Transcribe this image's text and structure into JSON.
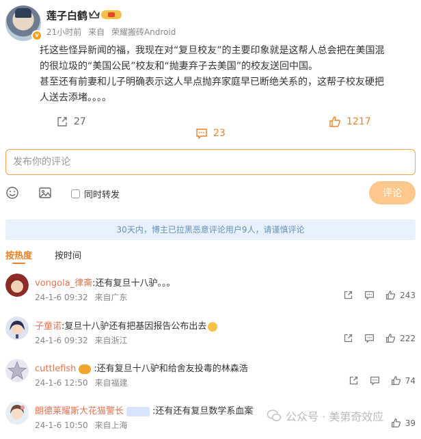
{
  "post": {
    "author": "莲子白鹤",
    "time": "21小时前",
    "source_prefix": "来自",
    "source": "荣耀搬砖Android",
    "body_lines": [
      "托这些怪异新闻的福，我现在对“复旦校友”的主要印象就是这帮人总会把在美国混",
      "的很垃圾的“美国公民”校友和“抛妻弃子去美国”的校友送回中国。",
      "甚至还有前妻和儿子明确表示这人早点抛弃家庭早已断绝关系的，这帮子校友硬把",
      "人送去添堵。。。。"
    ],
    "repost_count": "27",
    "comment_count": "23",
    "like_count": "1217"
  },
  "composer": {
    "placeholder": "发布你的评论",
    "repost_label": "同时转发",
    "submit_label": "评论"
  },
  "notice": "30天内，博主已拉黑恶意评论用户9人，请谨慎评论",
  "sort": {
    "hot_label": "按热度",
    "time_label": "按时间"
  },
  "comments": [
    {
      "user": "vongola_律斋",
      "text": ":还有复旦十八驴。。。",
      "date": "24-1-6 09:32",
      "location": "来自广东",
      "likes": "243"
    },
    {
      "user": "子童诺",
      "text": ":复旦十八驴还有把基因报告公布出去",
      "date": "24-1-6 09:32",
      "location": "来自浙江",
      "likes": "222"
    },
    {
      "user": "cuttlefish",
      "text": ":还有复旦十八驴和给舍友投毒的林森浩",
      "date": "24-1-6 12:50",
      "location": "来自福建",
      "likes": "74"
    },
    {
      "user": "朗德莱耀斯大花猫警长",
      "text": ":还有还有复旦数学系血案",
      "date": "24-1-6 10:50",
      "location": "来自上海",
      "likes": "39"
    }
  ],
  "watermark": "公众号 · 美第奇效应",
  "colors": {
    "accent": "#f08024",
    "username": "#eb7350",
    "notice_bg": "#e6f1fb",
    "submit_bg": "#fcc88c"
  }
}
